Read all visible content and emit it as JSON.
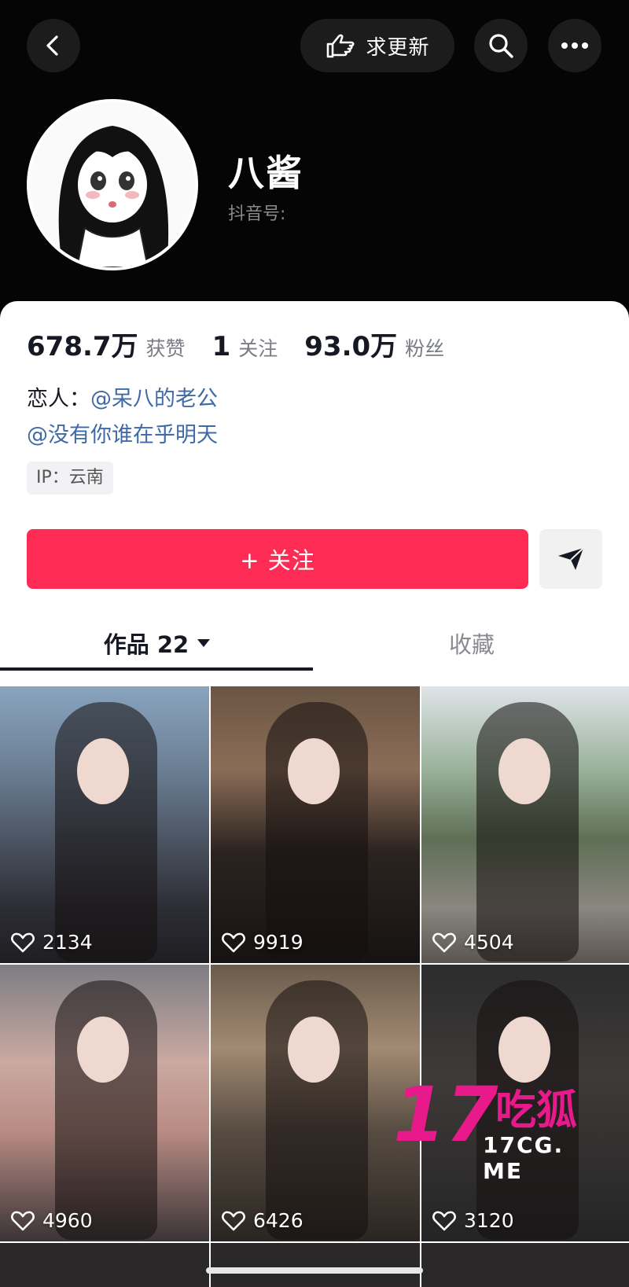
{
  "header": {
    "update_label": "求更新",
    "username": "八酱",
    "douyin_id_label": "抖音号:"
  },
  "stats": {
    "likes_value": "678.7万",
    "likes_label": "获赞",
    "following_value": "1",
    "following_label": "关注",
    "followers_value": "93.0万",
    "followers_label": "粉丝"
  },
  "bio": {
    "line1_prefix": "恋人：",
    "line1_mention": "@呆八的老公",
    "line2_mention": "@没有你谁在乎明天"
  },
  "ip_tag": "IP：云南",
  "actions": {
    "follow_label": "+ 关注"
  },
  "tabs": {
    "works_label": "作品 22",
    "favorites_label": "收藏"
  },
  "videos": [
    {
      "likes": "2134"
    },
    {
      "likes": "9919"
    },
    {
      "likes": "4504"
    },
    {
      "likes": "4960"
    },
    {
      "likes": "6426"
    },
    {
      "likes": "3120"
    }
  ],
  "watermark": {
    "number": "17",
    "name": "吃狐",
    "url": "17CG. ME"
  },
  "colors": {
    "follow_button": "#fe2c55",
    "mention": "#3f6aa6",
    "watermark": "#e8198b"
  },
  "icons": [
    "back-icon",
    "pointing-hand-icon",
    "search-icon",
    "more-icon",
    "share-icon",
    "chevron-down-icon",
    "heart-icon"
  ]
}
